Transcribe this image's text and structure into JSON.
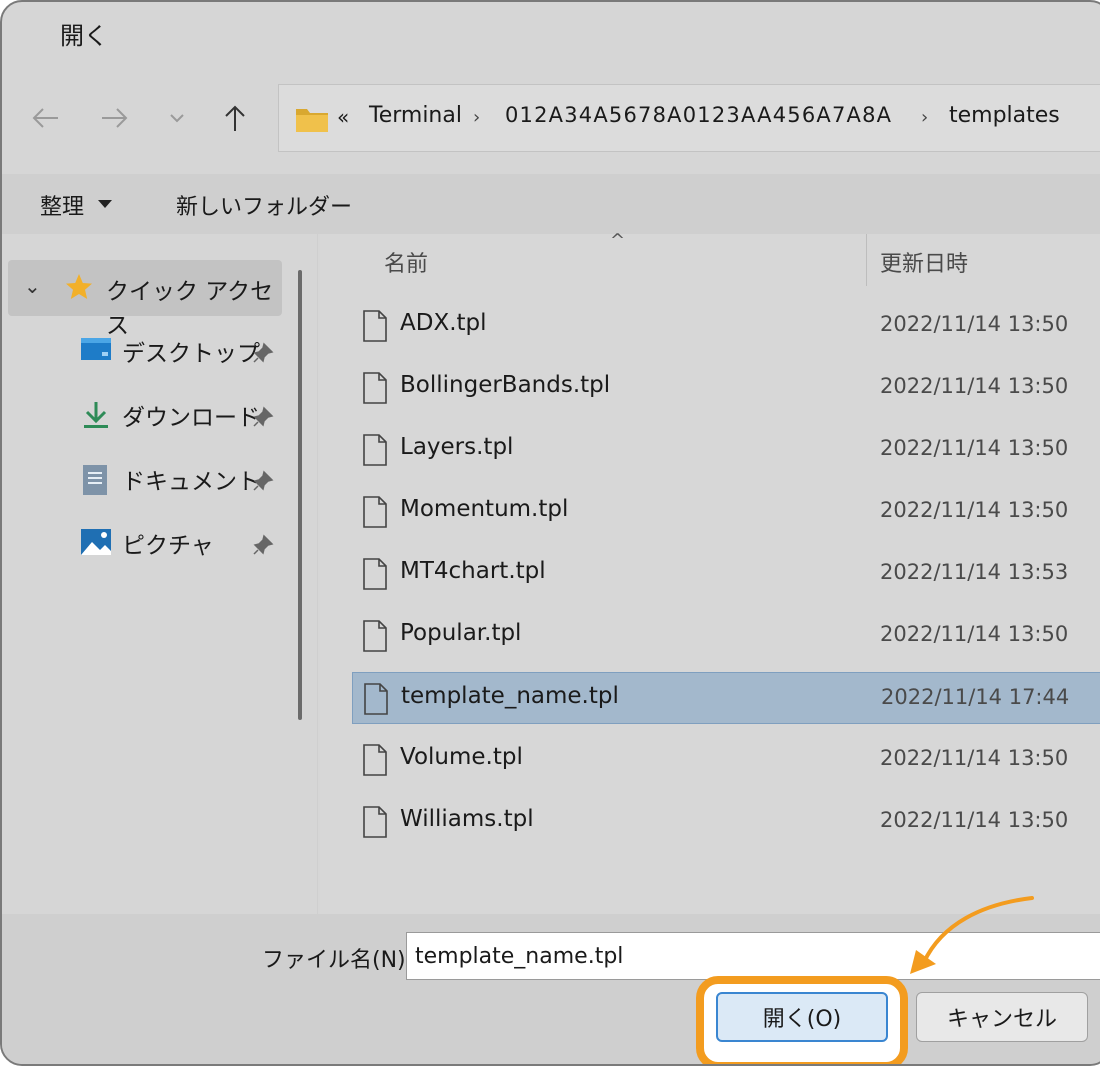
{
  "window": {
    "title": "開く"
  },
  "nav": {
    "back_icon": "arrow-left-icon",
    "forward_icon": "arrow-right-icon",
    "recent_icon": "chevron-down-icon",
    "up_icon": "arrow-up-icon"
  },
  "address": {
    "overflow": "«",
    "crumbs": [
      "Terminal",
      "012A34A5678A0123AA456A7A8A",
      "templates"
    ],
    "separator": "›"
  },
  "commands": {
    "organize": "整理",
    "new_folder": "新しいフォルダー"
  },
  "sidebar": {
    "quick_access": "クイック アクセス",
    "items": [
      {
        "label": "デスクトップ",
        "icon": "desktop-icon"
      },
      {
        "label": "ダウンロード",
        "icon": "download-icon"
      },
      {
        "label": "ドキュメント",
        "icon": "document-icon"
      },
      {
        "label": "ピクチャ",
        "icon": "picture-icon"
      }
    ]
  },
  "columns": {
    "name": "名前",
    "modified": "更新日時"
  },
  "files": [
    {
      "name": "ADX.tpl",
      "date": "2022/11/14 13:50",
      "selected": false
    },
    {
      "name": "BollingerBands.tpl",
      "date": "2022/11/14 13:50",
      "selected": false
    },
    {
      "name": "Layers.tpl",
      "date": "2022/11/14 13:50",
      "selected": false
    },
    {
      "name": "Momentum.tpl",
      "date": "2022/11/14 13:50",
      "selected": false
    },
    {
      "name": "MT4chart.tpl",
      "date": "2022/11/14 13:53",
      "selected": false
    },
    {
      "name": "Popular.tpl",
      "date": "2022/11/14 13:50",
      "selected": false
    },
    {
      "name": "template_name.tpl",
      "date": "2022/11/14 17:44",
      "selected": true
    },
    {
      "name": "Volume.tpl",
      "date": "2022/11/14 13:50",
      "selected": false
    },
    {
      "name": "Williams.tpl",
      "date": "2022/11/14 13:50",
      "selected": false
    }
  ],
  "footer": {
    "filename_label": "ファイル名(N):",
    "filename_value": "template_name.tpl",
    "open_label": "開く(O)",
    "cancel_label": "キャンセル"
  },
  "colors": {
    "highlight": "#f39c1f",
    "selection": "#a3b8cc",
    "primary_border": "#3a86d1"
  }
}
